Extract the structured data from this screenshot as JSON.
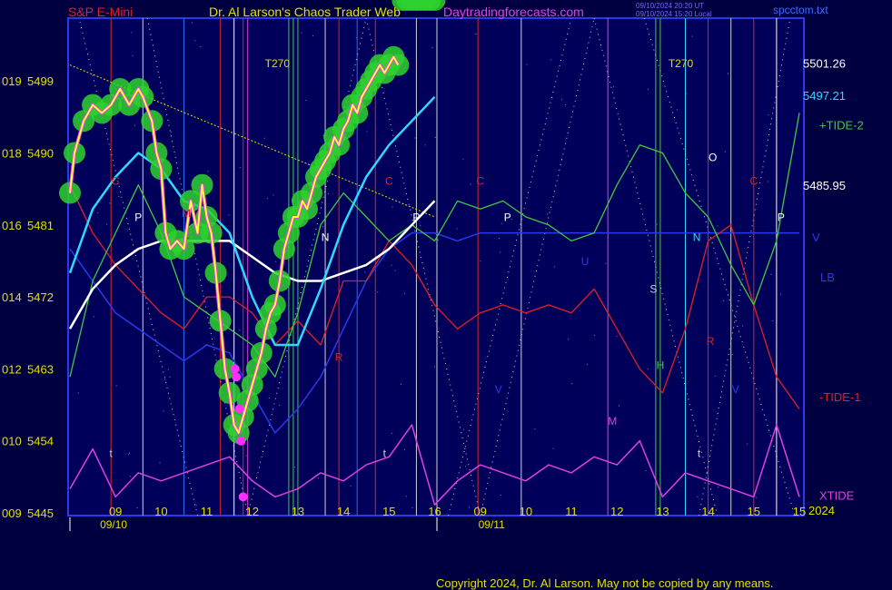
{
  "header": {
    "left_title": "S&P E-Mini",
    "center_title": "Dr. Al Larson's Chaos Trader Web",
    "site": "Daytradingforecasts.com",
    "stamp_line1": "09/10/2024 20:20 UT",
    "stamp_line2": "09/10/2024 15:20 Local",
    "file": "spcctom.txt"
  },
  "footer": {
    "copyright": "Copyright 2024, Dr. Al Larson. May not be copied by any means."
  },
  "colors": {
    "background": "#000040",
    "plot_bg": "#00005a",
    "price": "#ffff40",
    "price_glow": "#2ed22e",
    "avg_fast": "#30d8ff",
    "avg_slow": "#ffffff",
    "tide_plus": "#40c840",
    "tide_minus": "#e02020",
    "xtide": "#e040e0",
    "lb": "#2a3ae8",
    "axis_text": "#e0e000"
  },
  "chart_data": {
    "type": "line",
    "title": "S&P E-Mini",
    "ylim": [
      5445,
      5508
    ],
    "y_ticks": [
      {
        "value": 5445,
        "left": "009",
        "label": "5445"
      },
      {
        "value": 5454,
        "left": "010",
        "label": "5454"
      },
      {
        "value": 5463,
        "left": "012",
        "label": "5463"
      },
      {
        "value": 5472,
        "left": "014",
        "label": "5472"
      },
      {
        "value": 5481,
        "left": "016",
        "label": "5481"
      },
      {
        "value": 5490,
        "left": "018",
        "label": "5490"
      },
      {
        "value": 5499,
        "left": "019",
        "label": "5499"
      }
    ],
    "x_hours": [
      {
        "t": 1.0,
        "label": "09"
      },
      {
        "t": 2.0,
        "label": "10"
      },
      {
        "t": 3.0,
        "label": "11"
      },
      {
        "t": 4.0,
        "label": "12"
      },
      {
        "t": 5.0,
        "label": "13"
      },
      {
        "t": 6.0,
        "label": "14"
      },
      {
        "t": 7.0,
        "label": "15"
      },
      {
        "t": 8.0,
        "label": "16"
      },
      {
        "t": 9.0,
        "label": "09"
      },
      {
        "t": 10.0,
        "label": "10"
      },
      {
        "t": 11.0,
        "label": "11"
      },
      {
        "t": 12.0,
        "label": "12"
      },
      {
        "t": 13.0,
        "label": "13"
      },
      {
        "t": 14.0,
        "label": "14"
      },
      {
        "t": 15.0,
        "label": "15"
      },
      {
        "t": 16.0,
        "label": "15"
      }
    ],
    "dates": [
      {
        "t": 0.5,
        "label": "09/10"
      },
      {
        "t": 8.8,
        "label": "09/11"
      }
    ],
    "year": "2024",
    "right_labels": [
      {
        "value": 5501.26,
        "label": "5501.26",
        "color": "#ffffff"
      },
      {
        "value": 5497.21,
        "label": "5497.21",
        "color": "#30d8ff"
      },
      {
        "value": 5485.95,
        "label": "5485.95",
        "color": "#ffffff"
      }
    ],
    "series_labels": [
      {
        "name": "+TIDE-2",
        "value": 5493.5,
        "color": "#40c840"
      },
      {
        "name": "V",
        "value": 5479.5,
        "color": "#2a3ae8"
      },
      {
        "name": "LB",
        "value": 5474.5,
        "color": "#2a3ae8"
      },
      {
        "name": "-TIDE-1",
        "value": 5459.5,
        "color": "#e02020"
      },
      {
        "name": "XTIDE",
        "value": 5447.2,
        "color": "#e040e0"
      }
    ],
    "price": {
      "x": [
        0,
        0.1,
        0.3,
        0.5,
        0.7,
        0.9,
        1.1,
        1.3,
        1.5,
        1.6,
        1.8,
        1.9,
        2.0,
        2.1,
        2.2,
        2.35,
        2.5,
        2.65,
        2.8,
        2.9,
        3.0,
        3.1,
        3.2,
        3.3,
        3.4,
        3.5,
        3.6,
        3.7,
        3.8,
        3.9,
        4.0,
        4.1,
        4.2,
        4.3,
        4.4,
        4.5,
        4.6,
        4.7,
        4.8,
        4.9,
        5.0,
        5.1,
        5.2,
        5.3,
        5.4,
        5.5,
        5.6,
        5.7,
        5.8,
        5.9,
        6.0,
        6.1,
        6.2,
        6.3,
        6.4,
        6.5,
        6.6,
        6.7,
        6.8,
        6.9,
        7.0,
        7.1,
        7.2,
        7.3,
        7.4,
        7.5,
        7.6,
        7.7,
        7.8,
        7.9,
        8.0
      ],
      "y": [
        5485,
        5490,
        5494,
        5496,
        5495,
        5496,
        5498,
        5496,
        5498,
        5497,
        5494,
        5490,
        5488,
        5480,
        5478,
        5479,
        5478,
        5484,
        5480,
        5486,
        5482,
        5480,
        5475,
        5469,
        5463,
        5460,
        5456,
        5455,
        5457,
        5459,
        5461,
        5463,
        5465,
        5468,
        5470,
        5471,
        5474,
        5478,
        5480,
        5482,
        5482,
        5484,
        5483,
        5485,
        5487,
        5488,
        5489,
        5490,
        5492,
        5491,
        5493,
        5494,
        5496,
        5495,
        5497,
        5498,
        5499,
        5500,
        5501,
        5500,
        5501,
        5502,
        5501
      ]
    },
    "avg_fast": {
      "x": [
        0,
        0.5,
        1.0,
        1.5,
        2.0,
        2.5,
        3.0,
        3.5,
        4.0,
        4.5,
        5.0,
        5.5,
        6.0,
        6.5,
        7.0,
        7.5,
        8.0
      ],
      "y": [
        5475,
        5483,
        5487,
        5490,
        5488,
        5484,
        5483,
        5480,
        5472,
        5466,
        5466,
        5473,
        5481,
        5487,
        5491,
        5494,
        5497
      ]
    },
    "avg_slow": {
      "x": [
        0,
        0.5,
        1.0,
        1.5,
        2.0,
        2.5,
        3.0,
        3.5,
        4.0,
        4.5,
        5.0,
        5.5,
        6.0,
        6.5,
        7.0,
        7.5,
        8.0
      ],
      "y": [
        5468,
        5473,
        5476,
        5478,
        5479,
        5479,
        5479,
        5479,
        5477,
        5475,
        5474,
        5474,
        5475,
        5476,
        5478,
        5481,
        5484
      ]
    },
    "tide_plus": {
      "x": [
        0,
        0.5,
        1.0,
        1.5,
        2.0,
        2.5,
        3.0,
        3.5,
        4.0,
        4.5,
        5.0,
        5.5,
        6.0,
        6.5,
        7.0,
        7.5,
        8.0,
        8.5,
        9.0,
        9.5,
        10.0,
        10.5,
        11.0,
        11.5,
        12.0,
        12.5,
        13.0,
        13.5,
        14.0,
        14.5,
        15.0,
        15.5,
        16.0
      ],
      "y": [
        5462,
        5474,
        5480,
        5486,
        5480,
        5472,
        5470,
        5468,
        5466,
        5462,
        5470,
        5481,
        5485,
        5482,
        5479,
        5481,
        5479,
        5484,
        5483,
        5484,
        5482,
        5481,
        5479,
        5480,
        5486,
        5491,
        5490,
        5485,
        5482,
        5476,
        5471,
        5479,
        5495
      ]
    },
    "tide_minus": {
      "x": [
        0,
        0.5,
        1.0,
        1.5,
        2.0,
        2.5,
        3.0,
        3.5,
        4.0,
        4.5,
        5.0,
        5.5,
        6.0,
        6.5,
        7.0,
        7.5,
        8.0,
        8.5,
        9.0,
        9.5,
        10.0,
        10.5,
        11.0,
        11.5,
        12.0,
        12.5,
        13.0,
        13.5,
        14.0,
        14.5,
        15.0,
        15.5,
        16.0
      ],
      "y": [
        5486,
        5480,
        5476,
        5473,
        5470,
        5468,
        5472,
        5472,
        5470,
        5466,
        5469,
        5466,
        5474,
        5474,
        5479,
        5476,
        5471,
        5468,
        5470,
        5471,
        5470,
        5471,
        5470,
        5473,
        5468,
        5463,
        5460,
        5468,
        5479,
        5481,
        5471,
        5462,
        5458
      ]
    },
    "xtide": {
      "x": [
        0,
        0.5,
        1.0,
        1.5,
        2.0,
        2.5,
        3.0,
        3.5,
        4.0,
        4.5,
        5.0,
        5.5,
        6.0,
        6.5,
        7.0,
        7.5,
        8.0,
        8.5,
        9.0,
        9.5,
        10.0,
        10.5,
        11.0,
        11.5,
        12.0,
        12.5,
        13.0,
        13.5,
        14.0,
        14.5,
        15.0,
        15.5,
        16.0
      ],
      "y": [
        5448,
        5453,
        5447,
        5450,
        5449,
        5450,
        5451,
        5452,
        5449,
        5447,
        5448,
        5450,
        5449,
        5451,
        5452,
        5456,
        5446,
        5449,
        5451,
        5450,
        5449,
        5451,
        5450,
        5452,
        5451,
        5454,
        5447,
        5450,
        5449,
        5448,
        5447,
        5456,
        5447
      ]
    },
    "lb": {
      "x": [
        0,
        0.5,
        1.0,
        1.5,
        2.0,
        2.5,
        3.0,
        3.5,
        4.0,
        4.5,
        5.0,
        5.5,
        6.0,
        6.5,
        7.0,
        7.5,
        8.0,
        8.5,
        9.0,
        10.0,
        11.0,
        12.0,
        13.0,
        14.0,
        15.0,
        16.0
      ],
      "y": [
        5478,
        5474,
        5470,
        5468,
        5466,
        5464,
        5466,
        5465,
        5460,
        5455,
        5458,
        5462,
        5468,
        5474,
        5478,
        5480,
        5480,
        5479,
        5480,
        5480,
        5480,
        5480,
        5480,
        5480,
        5480,
        5480
      ]
    },
    "trendline": {
      "x": [
        0,
        8.0
      ],
      "y": [
        5501,
        5482
      ]
    },
    "vlines": [
      {
        "t": 0.9,
        "color": "#d02828"
      },
      {
        "t": 1.6,
        "color": "#d0d0d0"
      },
      {
        "t": 2.5,
        "color": "#2a6cf0"
      },
      {
        "t": 3.3,
        "color": "#d02828"
      },
      {
        "t": 3.6,
        "color": "#ffffff"
      },
      {
        "t": 3.8,
        "color": "#d02828"
      },
      {
        "t": 3.9,
        "color": "#e040e0"
      },
      {
        "t": 4.8,
        "color": "#40c840"
      },
      {
        "t": 4.9,
        "color": "#40c840"
      },
      {
        "t": 5.0,
        "color": "#40c840"
      },
      {
        "t": 5.6,
        "color": "#d0d0d0"
      },
      {
        "t": 5.9,
        "color": "#d02828"
      },
      {
        "t": 6.3,
        "color": "#2a6cf0"
      },
      {
        "t": 6.7,
        "color": "#d02828"
      },
      {
        "t": 7.6,
        "color": "#d0d0d0"
      },
      {
        "t": 8.05,
        "color": "#d0d0d0"
      },
      {
        "t": 8.95,
        "color": "#d02828"
      },
      {
        "t": 9.9,
        "color": "#d0d0d0"
      },
      {
        "t": 11.8,
        "color": "#e040e0"
      },
      {
        "t": 12.85,
        "color": "#40c840"
      },
      {
        "t": 12.95,
        "color": "#40c840"
      },
      {
        "t": 13.5,
        "color": "#30d8ff"
      },
      {
        "t": 14.0,
        "color": "#d02828"
      },
      {
        "t": 14.5,
        "color": "#d0d0d0"
      },
      {
        "t": 15.0,
        "color": "#d02828"
      },
      {
        "t": 15.5,
        "color": "#ffffff"
      }
    ],
    "markers": [
      {
        "t": 1.0,
        "value": 5486,
        "label": "C",
        "color": "#e02020"
      },
      {
        "t": 1.5,
        "value": 5481.5,
        "label": "P",
        "color": "#ffffff"
      },
      {
        "t": 2.55,
        "value": 5482,
        "label": "M",
        "color": "#e02020"
      },
      {
        "t": 5.6,
        "value": 5479,
        "label": "N",
        "color": "#ffffff"
      },
      {
        "t": 5.9,
        "value": 5464,
        "label": "R",
        "color": "#e02020"
      },
      {
        "t": 7.0,
        "value": 5486,
        "label": "C",
        "color": "#e02020"
      },
      {
        "t": 7.6,
        "value": 5481.5,
        "label": "P",
        "color": "#ffffff"
      },
      {
        "t": 9.0,
        "value": 5486,
        "label": "C",
        "color": "#e02020"
      },
      {
        "t": 9.6,
        "value": 5481.5,
        "label": "P",
        "color": "#ffffff"
      },
      {
        "t": 9.4,
        "value": 5460,
        "label": "V",
        "color": "#2a3ae8"
      },
      {
        "t": 11.3,
        "value": 5476,
        "label": "U",
        "color": "#2a3ae8"
      },
      {
        "t": 11.9,
        "value": 5456,
        "label": "M",
        "color": "#e040e0"
      },
      {
        "t": 12.8,
        "value": 5472.5,
        "label": "S",
        "color": "#d0d0d0"
      },
      {
        "t": 12.95,
        "value": 5463,
        "label": "H",
        "color": "#40c840"
      },
      {
        "t": 13.75,
        "value": 5479,
        "label": "N",
        "color": "#30d8ff"
      },
      {
        "t": 14.1,
        "value": 5489,
        "label": "O",
        "color": "#ffffff"
      },
      {
        "t": 14.05,
        "value": 5466,
        "label": "R",
        "color": "#e02020"
      },
      {
        "t": 14.6,
        "value": 5460,
        "label": "V",
        "color": "#2a3ae8"
      },
      {
        "t": 15.0,
        "value": 5486,
        "label": "C",
        "color": "#e02020"
      },
      {
        "t": 15.6,
        "value": 5481.5,
        "label": "P",
        "color": "#ffffff"
      },
      {
        "t": 0.9,
        "value": 5452,
        "label": "t",
        "color": "#d0d0d0"
      },
      {
        "t": 6.9,
        "value": 5452,
        "label": "t",
        "color": "#d0d0d0"
      },
      {
        "t": 13.8,
        "value": 5452,
        "label": "t",
        "color": "#d0d0d0"
      }
    ],
    "top_labels": [
      {
        "t": 4.55,
        "label": "T270"
      },
      {
        "t": 13.4,
        "label": "T270"
      }
    ],
    "pink_dots": [
      {
        "t": 3.62,
        "value": 5463
      },
      {
        "t": 3.65,
        "value": 5462
      },
      {
        "t": 3.72,
        "value": 5458
      },
      {
        "t": 3.75,
        "value": 5454
      },
      {
        "t": 3.8,
        "value": 5447
      }
    ]
  }
}
